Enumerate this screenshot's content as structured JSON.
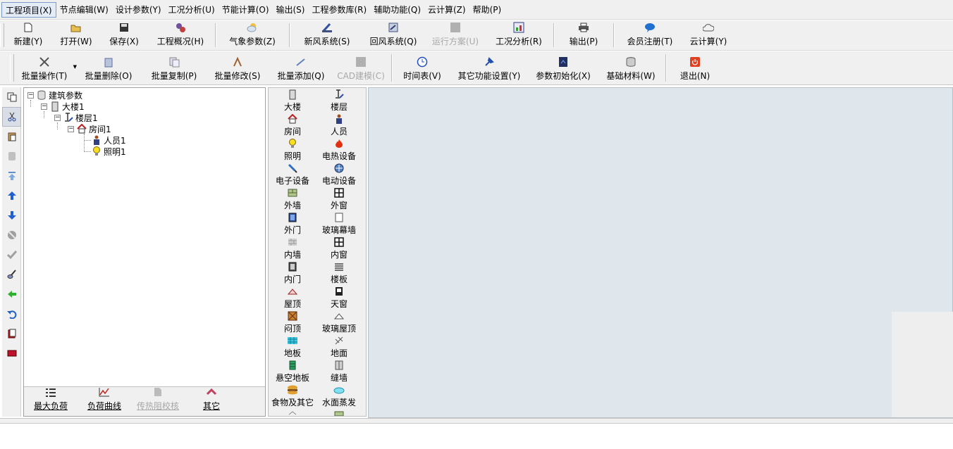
{
  "menu": [
    {
      "label": "工程项目(X)"
    },
    {
      "label": "节点编辑(W)"
    },
    {
      "label": "设计参数(Y)"
    },
    {
      "label": "工况分析(U)"
    },
    {
      "label": "节能计算(O)"
    },
    {
      "label": "输出(S)"
    },
    {
      "label": "工程参数库(R)"
    },
    {
      "label": "辅助功能(Q)"
    },
    {
      "label": "云计算(Z)"
    },
    {
      "label": "帮助(P)"
    }
  ],
  "toolbar1": {
    "new": "新建(Y)",
    "open": "打开(W)",
    "save": "保存(X)",
    "overview": "工程概况(H)",
    "weather": "气象参数(Z)",
    "fresh_air": "新风系统(S)",
    "return_air": "回风系统(Q)",
    "run_plan": "运行方案(U)",
    "condition": "工况分析(R)",
    "output": "输出(P)",
    "register": "会员注册(T)",
    "cloud": "云计算(Y)"
  },
  "toolbar2": {
    "batch_op": "批量操作(T)",
    "batch_delete": "批量删除(O)",
    "batch_copy": "批量复制(P)",
    "batch_modify": "批量修改(S)",
    "batch_add": "批量添加(Q)",
    "cad_model": "CAD建模(C)",
    "schedule": "时间表(V)",
    "other_settings": "其它功能设置(Y)",
    "param_init": "参数初始化(X)",
    "base_material": "基础材料(W)",
    "exit": "退出(N)"
  },
  "tree": {
    "root": "建筑参数",
    "building": "大楼1",
    "floor": "楼层1",
    "room": "房间1",
    "person": "人员1",
    "lighting": "照明1"
  },
  "tree_bottom": {
    "max_load": "最大负荷",
    "load_curve": "负荷曲线",
    "heat_check": "传热阻校核",
    "other": "其它"
  },
  "palette": [
    "大楼",
    "楼层",
    "房间",
    "人员",
    "照明",
    "电热设备",
    "电子设备",
    "电动设备",
    "外墙",
    "外窗",
    "外门",
    "玻璃幕墙",
    "内墙",
    "内窗",
    "内门",
    "楼板",
    "屋顶",
    "天窗",
    "闷顶",
    "玻璃屋顶",
    "地板",
    "地面",
    "悬空地板",
    "缝墙",
    "食物及其它",
    "水面蒸发"
  ],
  "colors": {
    "chrome": "#f0f0f0",
    "workspace": "#dfe6ec",
    "disabled_text": "#a8a8a8"
  }
}
